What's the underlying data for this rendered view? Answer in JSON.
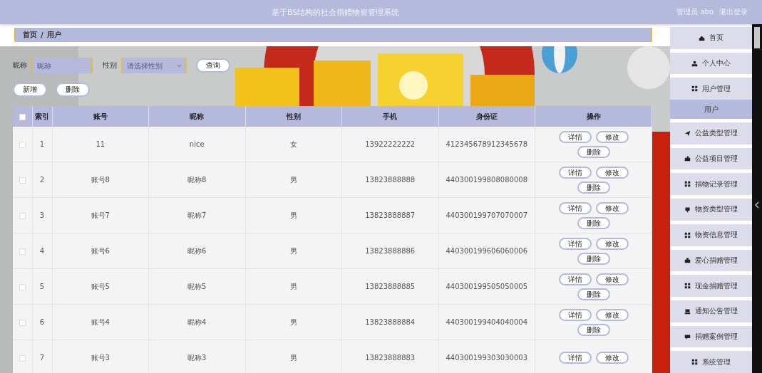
{
  "header": {
    "title": "基于BS结构的社会捐赠物资管理系统",
    "user": "管理员 abo",
    "logout": "退出登录"
  },
  "breadcrumb": [
    "首页",
    "用户"
  ],
  "breadcrumb_separator": "/",
  "search": {
    "fields": [
      {
        "label": "昵称",
        "placeholder": "昵称",
        "kind": "input"
      },
      {
        "label": "性别",
        "placeholder": "请选择性别",
        "kind": "select"
      }
    ],
    "button": "查询"
  },
  "actions": [
    "新增",
    "删除"
  ],
  "table": {
    "select_all": {
      "checked": false
    },
    "columns": [
      "索引",
      "账号",
      "昵称",
      "性别",
      "手机",
      "身份证",
      "操作"
    ],
    "rows": [
      {
        "checked": false,
        "cells": [
          "1",
          "11",
          "nice",
          "女",
          "13922222222",
          "412345678912345678"
        ],
        "actions": [
          "详情",
          "修改",
          "删除"
        ]
      },
      {
        "checked": false,
        "cells": [
          "2",
          "账号8",
          "昵称8",
          "男",
          "13823888888",
          "440300199808080008"
        ],
        "actions": [
          "详情",
          "修改",
          "删除"
        ]
      },
      {
        "checked": false,
        "cells": [
          "3",
          "账号7",
          "昵称7",
          "男",
          "13823888887",
          "440300199707070007"
        ],
        "actions": [
          "详情",
          "修改",
          "删除"
        ]
      },
      {
        "checked": false,
        "cells": [
          "4",
          "账号6",
          "昵称6",
          "男",
          "13823888886",
          "440300199606060006"
        ],
        "actions": [
          "详情",
          "修改",
          "删除"
        ]
      },
      {
        "checked": false,
        "cells": [
          "5",
          "账号5",
          "昵称5",
          "男",
          "13823888885",
          "440300199505050005"
        ],
        "actions": [
          "详情",
          "修改",
          "删除"
        ]
      },
      {
        "checked": false,
        "cells": [
          "6",
          "账号4",
          "昵称4",
          "男",
          "13823888884",
          "440300199404040004"
        ],
        "actions": [
          "详情",
          "修改",
          "删除"
        ]
      },
      {
        "checked": false,
        "cells": [
          "7",
          "账号3",
          "昵称3",
          "男",
          "13823888883",
          "440300199303030003"
        ],
        "actions": [
          "详情",
          "修改"
        ]
      }
    ]
  },
  "sidebar": {
    "items": [
      {
        "label": "首页",
        "selected": false
      },
      {
        "label": "个人中心",
        "selected": false
      },
      {
        "label": "用户管理",
        "selected": false,
        "children": [
          {
            "label": "用户",
            "selected": true
          }
        ]
      },
      {
        "label": "公益类型管理",
        "selected": false
      },
      {
        "label": "公益项目管理",
        "selected": false
      },
      {
        "label": "捐物记录管理",
        "selected": false
      },
      {
        "label": "物资类型管理",
        "selected": false
      },
      {
        "label": "物资信息管理",
        "selected": false
      },
      {
        "label": "爱心捐赠管理",
        "selected": false
      },
      {
        "label": "现金捐赠管理",
        "selected": false
      },
      {
        "label": "通知公告管理",
        "selected": false
      },
      {
        "label": "捐赠案例管理",
        "selected": false
      },
      {
        "label": "系统管理",
        "selected": false
      }
    ]
  }
}
